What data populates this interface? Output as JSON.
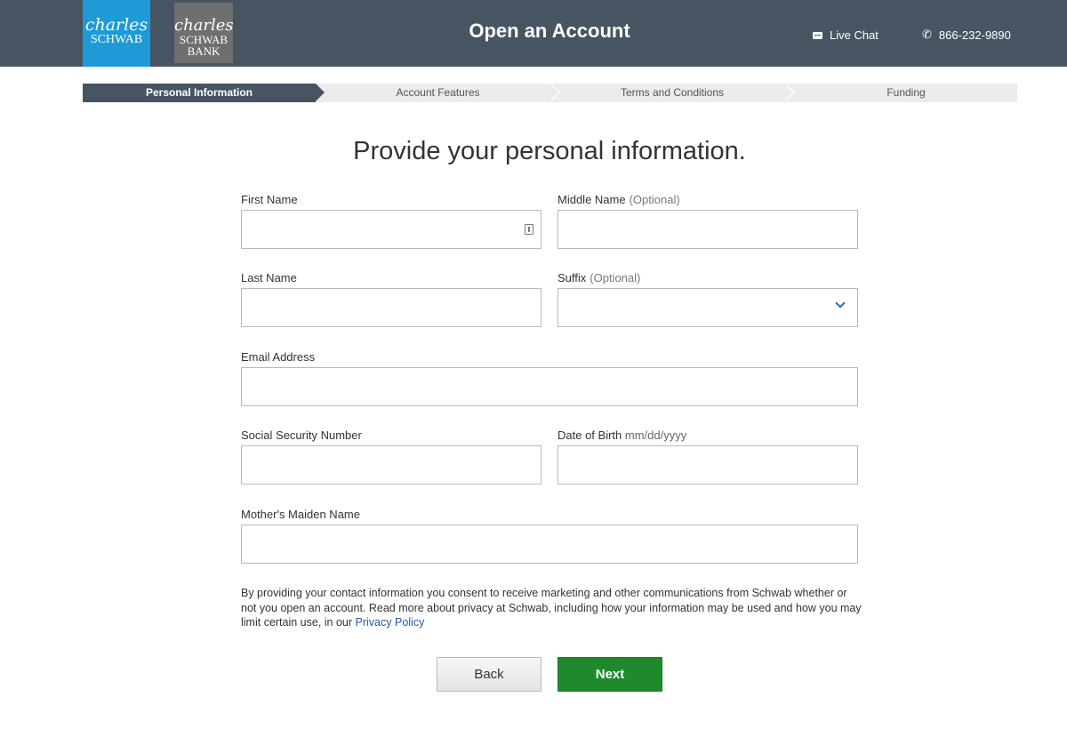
{
  "header": {
    "logo_primary": {
      "script": "charles",
      "caps": "SCHWAB"
    },
    "logo_bank": {
      "script": "charles",
      "caps_line1": "SCHWAB",
      "caps_line2": "BANK"
    },
    "title": "Open an Account",
    "live_chat_label": "Live Chat",
    "live_chat_icon": "chat-icon",
    "phone_number": "866-232-9890",
    "phone_icon": "phone-icon",
    "colors": {
      "header_bg": "#475563",
      "logo_blue": "#1e9ad6",
      "logo_bank_grey": "#6f6f6f"
    }
  },
  "stepper": {
    "steps": [
      {
        "label": "Personal Information",
        "active": true
      },
      {
        "label": "Account Features",
        "active": false
      },
      {
        "label": "Terms and Conditions",
        "active": false
      },
      {
        "label": "Funding",
        "active": false
      }
    ]
  },
  "form": {
    "heading": "Provide your personal information.",
    "first_name": {
      "label": "First Name",
      "value": ""
    },
    "middle_name": {
      "label": "Middle Name",
      "optional": "(Optional)",
      "value": ""
    },
    "last_name": {
      "label": "Last Name",
      "value": ""
    },
    "suffix": {
      "label": "Suffix",
      "optional": "(Optional)",
      "value": ""
    },
    "email": {
      "label": "Email Address",
      "value": ""
    },
    "ssn": {
      "label": "Social Security Number",
      "value": ""
    },
    "dob": {
      "label": "Date of Birth",
      "hint": "mm/dd/yyyy",
      "value": ""
    },
    "maiden_name": {
      "label": "Mother's Maiden Name",
      "value": ""
    }
  },
  "consent": {
    "text": "By providing your contact information you consent to receive marketing and other communications from Schwab whether or not you open an account. Read more about privacy at Schwab, including how your information may be used and how you may limit certain use, in our ",
    "link_label": "Privacy Policy"
  },
  "buttons": {
    "back_label": "Back",
    "next_label": "Next",
    "next_color": "#1e8a2c"
  }
}
